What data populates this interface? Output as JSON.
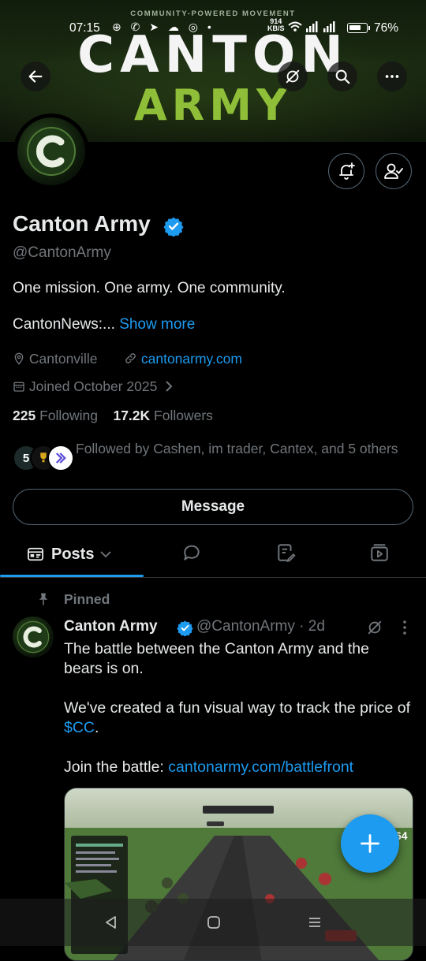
{
  "status_bar": {
    "time": "07:15",
    "app_icons": "⊕ ✆ ➤ ☁ ◎ •",
    "speed_value": "914",
    "speed_unit": "KB/S",
    "battery_percent": "76%",
    "battery_level": 0.76
  },
  "banner": {
    "tagline": "COMMUNITY-POWERED MOVEMENT",
    "title_line1": "CANTON",
    "title_line2": "ARMY",
    "accent_color": "#8fbe38"
  },
  "profile": {
    "name": "Canton Army",
    "handle": "@CantonArmy",
    "bio_line1": "One mission. One army. One community.",
    "bio_line2_prefix": "CantonNews:...",
    "show_more": "Show more",
    "location": "Cantonville",
    "website": "cantonarmy.com",
    "joined": "Joined October 2025",
    "following_count": "225",
    "following_label": "Following",
    "followers_count": "17.2K",
    "followers_label": "Followers",
    "followed_by": "Followed by Cashen, im trader, Cantex, and 5 others"
  },
  "actions": {
    "message": "Message"
  },
  "tabs": {
    "posts": "Posts"
  },
  "post": {
    "pinned_label": "Pinned",
    "author_name": "Canton Army",
    "author_handle": "@CantonArmy",
    "separator": "·",
    "age": "2d",
    "line1": "The battle between the Canton Army and the bears is on.",
    "line2_prefix": "We've created a fun visual way to track the price of ",
    "cashtag": "$CC",
    "line2_suffix": ".",
    "line3_prefix": "Join the battle: ",
    "line3_link": "cantonarmy.com/battlefront"
  },
  "media": {
    "corner_number": "64"
  },
  "colors": {
    "link_blue": "#1d9bf0",
    "muted_gray": "#71767b",
    "text": "#e7e9ea",
    "border": "#2f3336"
  }
}
